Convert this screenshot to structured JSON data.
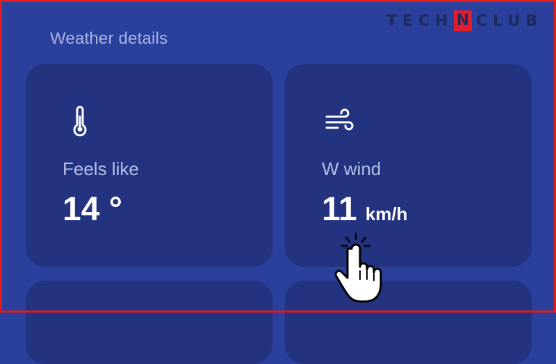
{
  "header": {
    "section_title": "Weather details"
  },
  "watermark": {
    "text_left": "TECH",
    "mark": "N",
    "text_right": "CLUB"
  },
  "cards": [
    {
      "icon": "thermometer-icon",
      "label": "Feels like",
      "value": "14 °",
      "unit": ""
    },
    {
      "icon": "wind-icon",
      "label": "W wind",
      "value": "11",
      "unit": "km/h"
    }
  ],
  "colors": {
    "background": "#2b3f9c",
    "card": "#23337f",
    "label": "#b6bfe9",
    "frame": "#e11a1a"
  }
}
